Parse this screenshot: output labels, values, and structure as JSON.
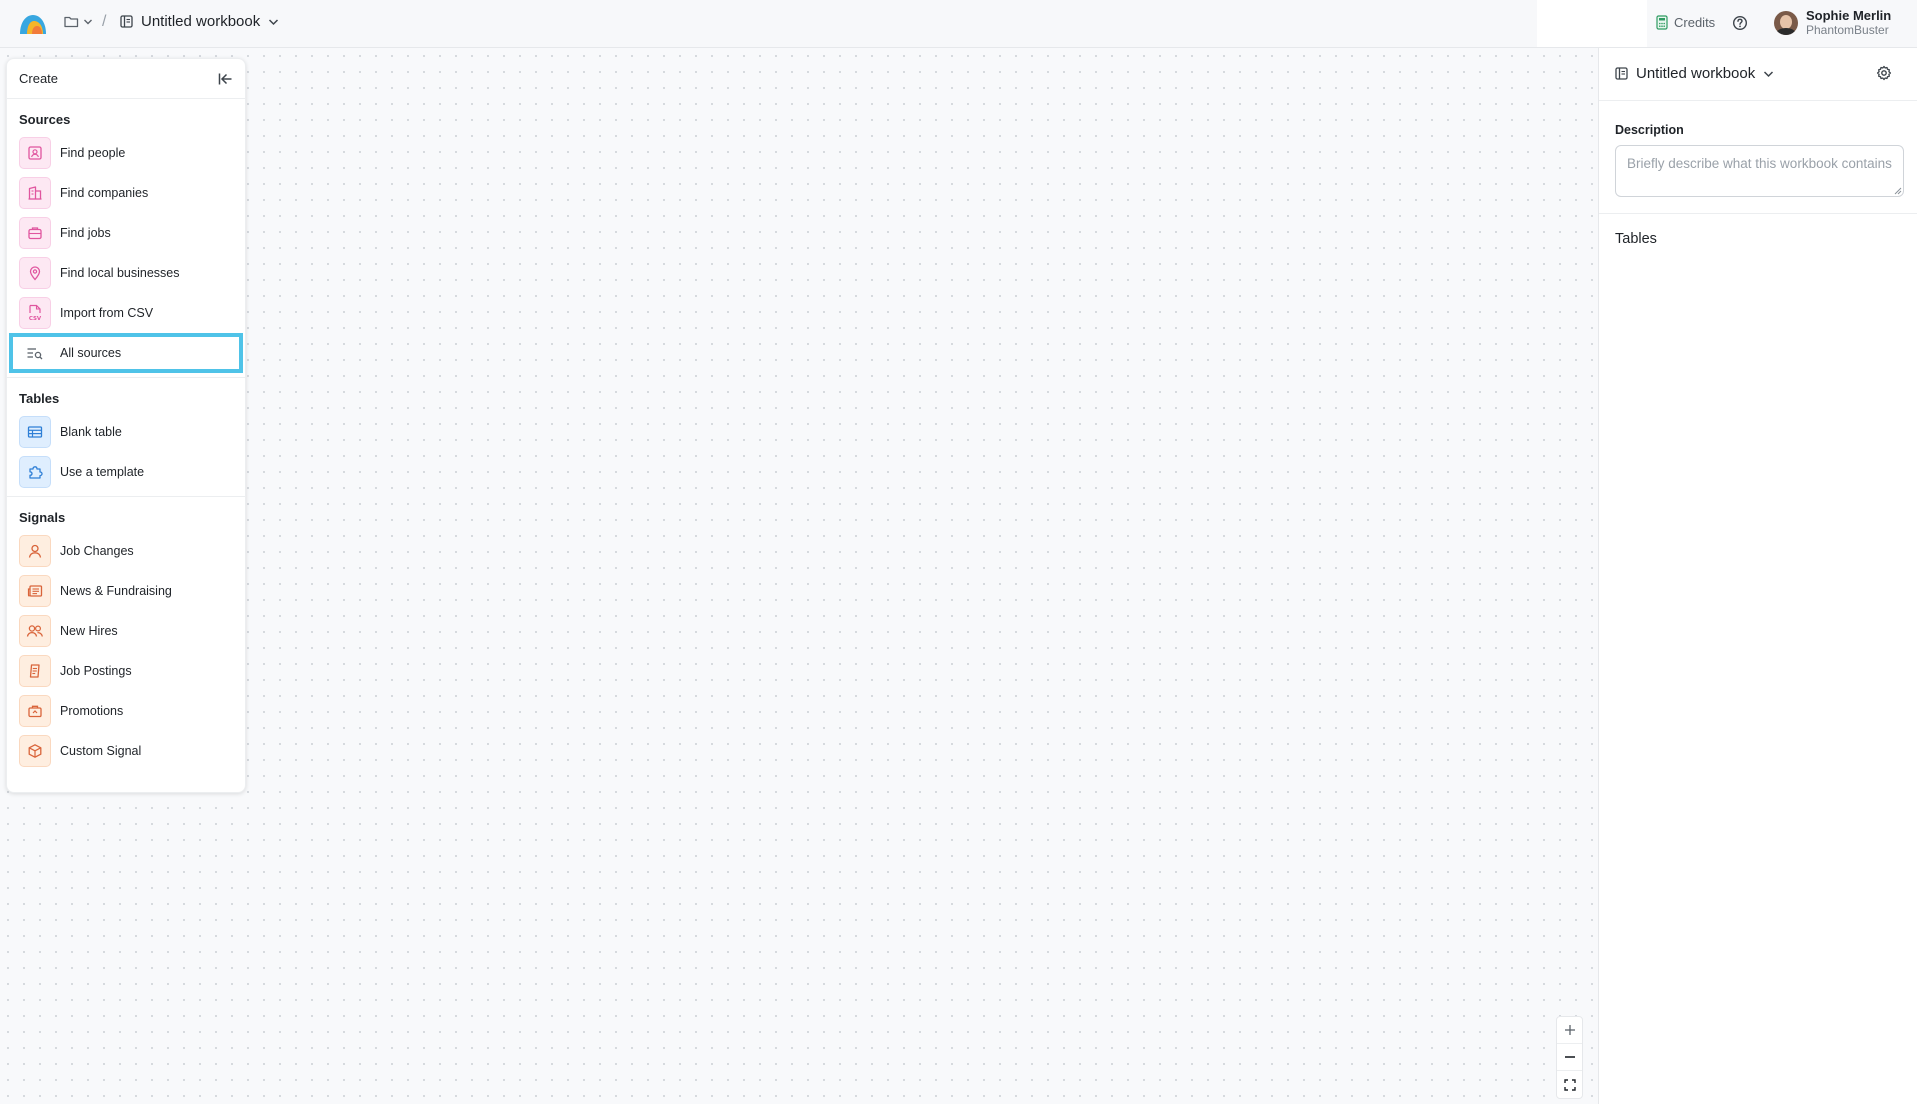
{
  "topbar": {
    "workbook_title": "Untitled workbook",
    "credits_label": "Credits",
    "user_name": "Sophie Merlin",
    "user_org": "PhantomBuster"
  },
  "create_panel": {
    "title": "Create",
    "sections": [
      {
        "title": "Sources",
        "items": [
          {
            "label": "Find people",
            "icon": "person-card-icon"
          },
          {
            "label": "Find companies",
            "icon": "building-icon"
          },
          {
            "label": "Find jobs",
            "icon": "briefcase-icon"
          },
          {
            "label": "Find local businesses",
            "icon": "map-pin-icon"
          },
          {
            "label": "Import from CSV",
            "icon": "csv-file-icon"
          },
          {
            "label": "All sources",
            "icon": "list-search-icon",
            "selected": true
          }
        ]
      },
      {
        "title": "Tables",
        "items": [
          {
            "label": "Blank table",
            "icon": "table-icon"
          },
          {
            "label": "Use a template",
            "icon": "puzzle-icon"
          }
        ]
      },
      {
        "title": "Signals",
        "items": [
          {
            "label": "Job Changes",
            "icon": "person-icon"
          },
          {
            "label": "News & Fundraising",
            "icon": "newspaper-icon"
          },
          {
            "label": "New Hires",
            "icon": "people-icon"
          },
          {
            "label": "Job Postings",
            "icon": "clipboard-icon"
          },
          {
            "label": "Promotions",
            "icon": "briefcase-up-icon"
          },
          {
            "label": "Custom Signal",
            "icon": "cube-icon"
          }
        ]
      }
    ]
  },
  "right_panel": {
    "workbook_title": "Untitled workbook",
    "description_label": "Description",
    "description_placeholder": "Briefly describe what this workbook contains",
    "description_value": "",
    "tables_label": "Tables"
  },
  "colors": {
    "selection_outline": "#4fc3e8",
    "source_icon_bg": "#fde8f3",
    "source_icon_stroke": "#e0559f",
    "table_icon_bg": "#dfeefe",
    "table_icon_stroke": "#2f7fd6",
    "signal_icon_bg": "#feeee0",
    "signal_icon_stroke": "#d9643a"
  }
}
